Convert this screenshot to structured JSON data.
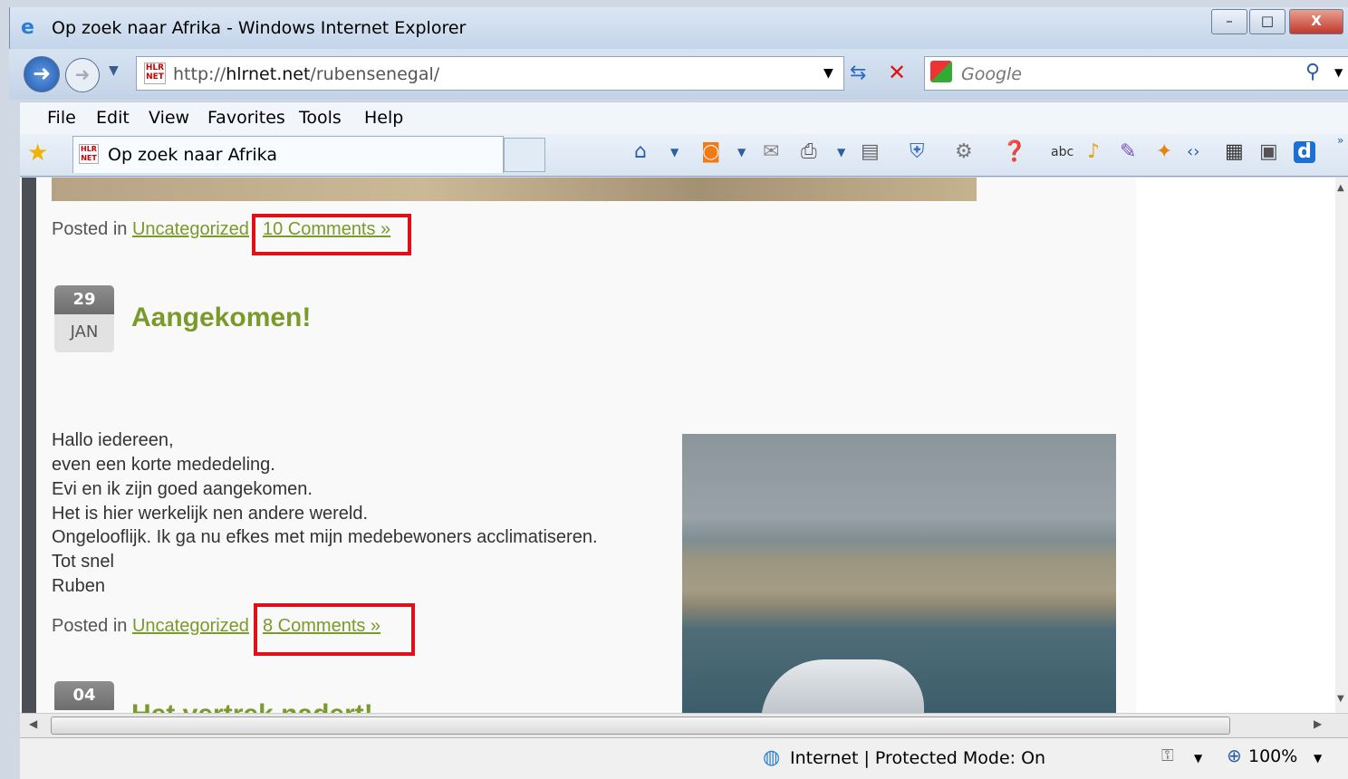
{
  "window": {
    "title": "Op zoek naar Afrika - Windows Internet Explorer",
    "minimize": "–",
    "maximize": "□",
    "close": "X"
  },
  "address": {
    "prefix": "http://",
    "domain": "hlrnet.net",
    "path": "/rubensenegal/"
  },
  "search": {
    "placeholder": "Google"
  },
  "menu": [
    "File",
    "Edit",
    "View",
    "Favorites",
    "Tools",
    "Help"
  ],
  "tab": {
    "title": "Op zoek naar Afrika"
  },
  "posts": [
    {
      "posted_in": "Posted in",
      "category": "Uncategorized",
      "comments": "10 Comments »"
    },
    {
      "day": "29",
      "month": "JAN",
      "title": "Aangekomen!",
      "body": [
        "Hallo iedereen,",
        "even een korte mededeling.",
        "Evi en ik zijn goed aangekomen.",
        "Het is hier werkelijk nen andere wereld.",
        "Ongelooflijk. Ik ga nu efkes met mijn medebewoners acclimatiseren.",
        "Tot snel",
        "Ruben"
      ],
      "posted_in": "Posted in",
      "category": "Uncategorized",
      "comments": "8 Comments »"
    },
    {
      "day": "04",
      "title": "Het vertrek nadert!"
    }
  ],
  "status": {
    "zone": "Internet | Protected Mode: On",
    "zoom": "100%"
  },
  "colors": {
    "link": "#7a9a2a",
    "highlight": "#e0101a"
  }
}
